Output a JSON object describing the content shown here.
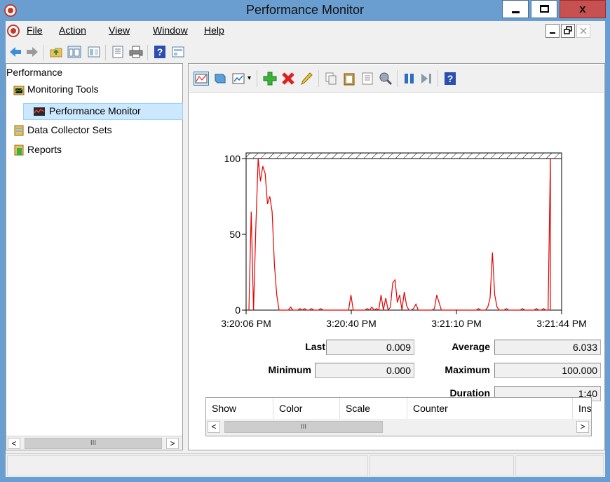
{
  "window": {
    "title": "Performance Monitor",
    "controls": {
      "minimize": "–",
      "maximize": "□",
      "close": "x"
    }
  },
  "menu": {
    "items": [
      "File",
      "Action",
      "View",
      "Window",
      "Help"
    ]
  },
  "tree": {
    "root": "Performance",
    "items": [
      {
        "label": "Monitoring Tools",
        "level": 1
      },
      {
        "label": "Performance Monitor",
        "level": 2,
        "selected": true
      },
      {
        "label": "Data Collector Sets",
        "level": 1
      },
      {
        "label": "Reports",
        "level": 1
      }
    ],
    "scroll_thumb": "III"
  },
  "chart_data": {
    "type": "line",
    "ylim": [
      0,
      100
    ],
    "ytick_labels": [
      "100",
      "50",
      "0"
    ],
    "xtick_labels": [
      "3:20:06 PM",
      "3:20:40 PM",
      "3:21:10 PM",
      "3:21:44 PM"
    ],
    "series_color": "#e60000",
    "series": [
      {
        "values": [
          0,
          65,
          0,
          55,
          100,
          85,
          95,
          90,
          70,
          75,
          65,
          30,
          10,
          0,
          0,
          0,
          0,
          0,
          2,
          0,
          0,
          0,
          1,
          0,
          1,
          0,
          0,
          1,
          0,
          0,
          0,
          1,
          0,
          0,
          0,
          0,
          0,
          0,
          0,
          0,
          0,
          0,
          0,
          0,
          10,
          0,
          0,
          0,
          0,
          0,
          0,
          1,
          0,
          2,
          0,
          1,
          0,
          10,
          0,
          8,
          0,
          2,
          18,
          20,
          5,
          10,
          0,
          12,
          3,
          0,
          0,
          1,
          4,
          0,
          0,
          0,
          0,
          0,
          0,
          0,
          1,
          10,
          5,
          0,
          0,
          0,
          0,
          0,
          0,
          0,
          0,
          0,
          0,
          0,
          0,
          0,
          0,
          0,
          0,
          1,
          0,
          0,
          0,
          2,
          8,
          38,
          10,
          2,
          0,
          0,
          0,
          1,
          0,
          0,
          0,
          0,
          0,
          0,
          1,
          0,
          0,
          0,
          0,
          0,
          1,
          0,
          0,
          1,
          0,
          0,
          100
        ]
      }
    ]
  },
  "stats": {
    "last": {
      "label": "Last",
      "value": "0.009"
    },
    "average": {
      "label": "Average",
      "value": "6.033"
    },
    "minimum": {
      "label": "Minimum",
      "value": "0.000"
    },
    "maximum": {
      "label": "Maximum",
      "value": "100.000"
    },
    "duration": {
      "label": "Duration",
      "value": "1:40"
    }
  },
  "counter_table": {
    "columns": [
      "Show",
      "Color",
      "Scale",
      "Counter",
      "Inst"
    ],
    "scroll_thumb": "III"
  }
}
